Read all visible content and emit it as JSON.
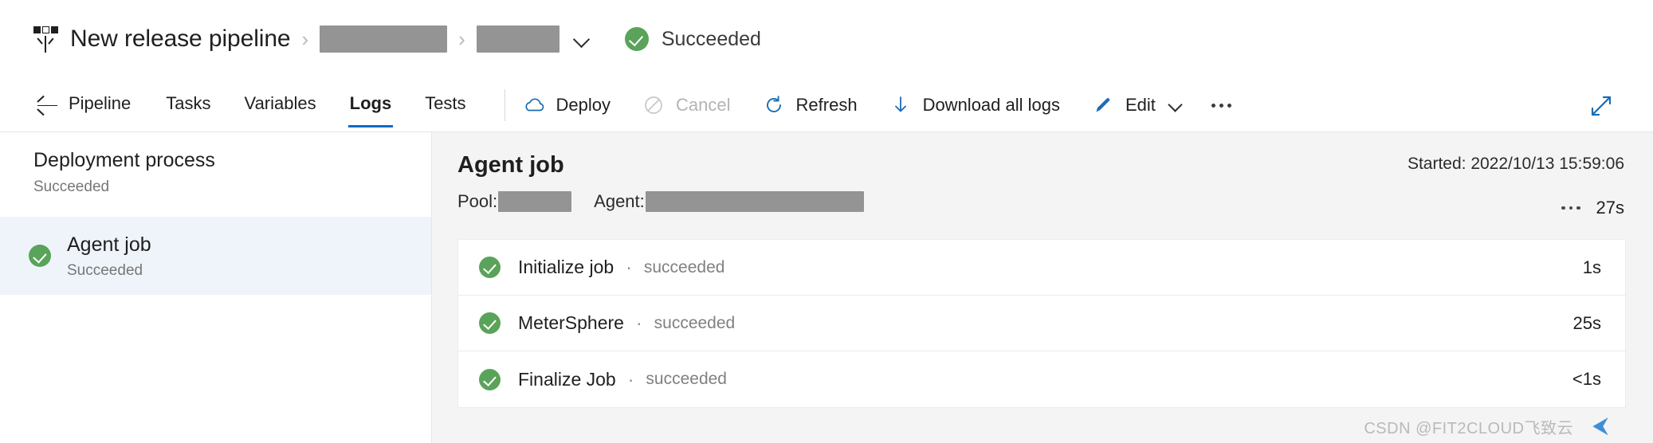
{
  "header": {
    "icon": "release-pipeline-icon",
    "title": "New release pipeline",
    "separator": "›",
    "breadcrumb_redacted_1": "",
    "breadcrumb_redacted_2": "",
    "caret_icon": "chevron-down-icon",
    "status_icon": "check-circle-icon",
    "status": "Succeeded",
    "status_color": "#5aa35a"
  },
  "toolbar": {
    "back_icon": "back-arrow-icon",
    "tabs": [
      {
        "label": "Pipeline",
        "active": false
      },
      {
        "label": "Tasks",
        "active": false
      },
      {
        "label": "Variables",
        "active": false
      },
      {
        "label": "Logs",
        "active": true
      },
      {
        "label": "Tests",
        "active": false
      }
    ],
    "active_tab_color": "#0c6ac7",
    "actions": [
      {
        "label": "Deploy",
        "icon": "cloud-icon",
        "disabled": false
      },
      {
        "label": "Cancel",
        "icon": "cancel-circle-icon",
        "disabled": true
      },
      {
        "label": "Refresh",
        "icon": "refresh-icon",
        "disabled": false
      },
      {
        "label": "Download all logs",
        "icon": "download-icon",
        "disabled": false
      },
      {
        "label": "Edit",
        "icon": "pencil-icon",
        "disabled": false
      }
    ],
    "overflow_icon": "more-horizontal-icon",
    "expand_icon": "expand-diagonal-icon",
    "icon_color": "#1b6cb5"
  },
  "sidebar": {
    "process": {
      "title": "Deployment process",
      "status": "Succeeded"
    },
    "jobs": [
      {
        "name": "Agent job",
        "status": "Succeeded",
        "icon": "check-circle-icon",
        "selected": true
      }
    ],
    "selected_bg": "#eff4fa"
  },
  "main": {
    "title": "Agent job",
    "pool_label": "Pool:",
    "pool_value_redacted": "",
    "agent_label": "Agent:",
    "agent_value_redacted": "",
    "started": "Started: 2022/10/13 15:59:06",
    "overflow_icon": "more-horizontal-icon",
    "duration": "27s",
    "separator_dot": "·",
    "log_rows": [
      {
        "name": "Initialize job",
        "status": "succeeded",
        "duration": "1s",
        "icon": "check-circle-icon"
      },
      {
        "name": "MeterSphere",
        "status": "succeeded",
        "duration": "25s",
        "icon": "check-circle-icon"
      },
      {
        "name": "Finalize Job",
        "status": "succeeded",
        "duration": "<1s",
        "icon": "check-circle-icon"
      }
    ]
  },
  "watermark": {
    "text": "CSDN @FIT2CLOUD飞致云",
    "arrow": "⮜"
  }
}
